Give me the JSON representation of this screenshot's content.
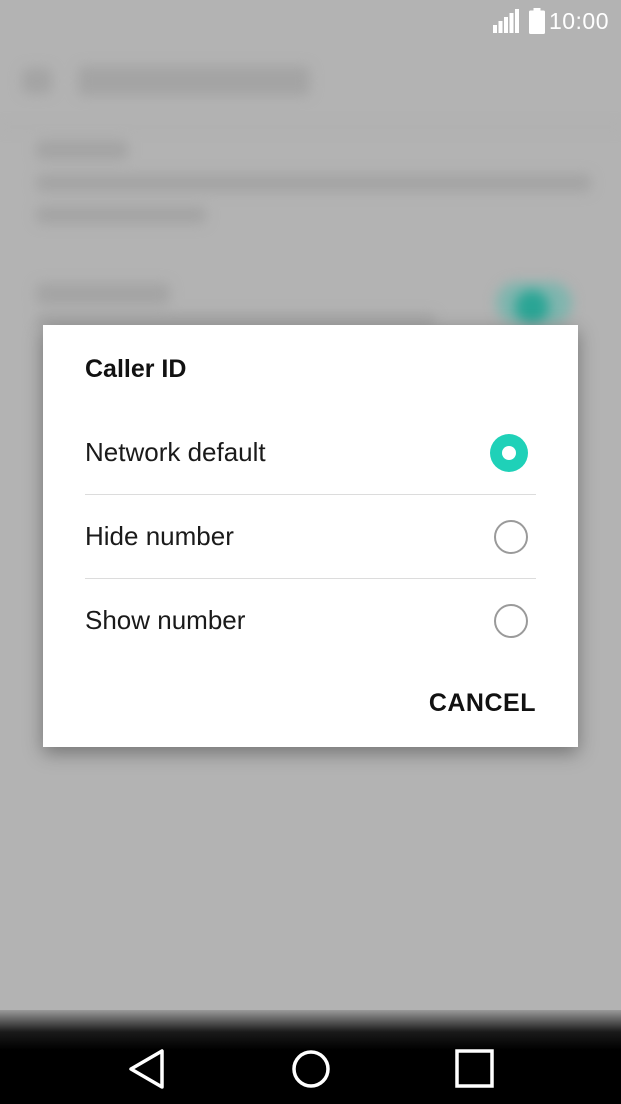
{
  "status_bar": {
    "time": "10:00",
    "icons": [
      "signal-icon",
      "battery-icon"
    ]
  },
  "dialog": {
    "title": "Caller ID",
    "options": [
      {
        "label": "Network default",
        "selected": true
      },
      {
        "label": "Hide number",
        "selected": false
      },
      {
        "label": "Show number",
        "selected": false
      }
    ],
    "cancel_label": "CANCEL"
  },
  "nav_bar": {
    "buttons": [
      "back-icon",
      "home-icon",
      "recents-icon"
    ]
  },
  "colors": {
    "accent": "#1fd1b8",
    "scrim": "#b3b3b3",
    "dialog_bg": "#ffffff"
  }
}
